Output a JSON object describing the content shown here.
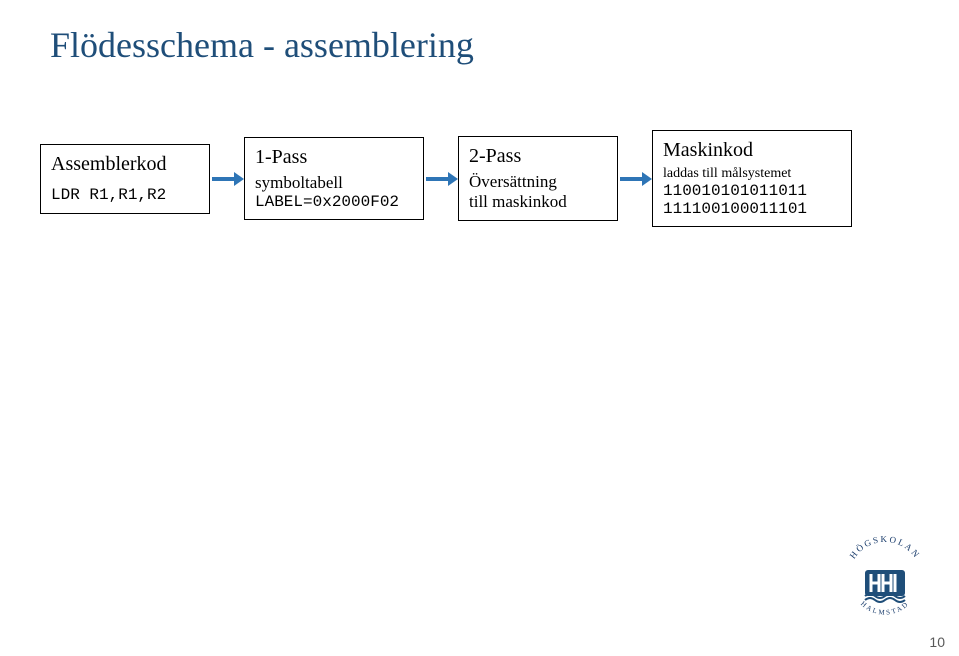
{
  "title": "Flödesschema - assemblering",
  "boxes": [
    {
      "head": "Assemblerkod",
      "sub1": "LDR R1,R1,R2",
      "sub1_style": "mono"
    },
    {
      "head": "1-Pass",
      "sub1": "symboltabell",
      "sub1_style": "serif",
      "sub2": "LABEL=0x2000F02",
      "sub2_style": "mono"
    },
    {
      "head": "2-Pass",
      "sub1": "Översättning",
      "sub1_style": "serif",
      "sub2": "till maskinkod",
      "sub2_style": "serif"
    },
    {
      "head": "Maskinkod",
      "sub1": "laddas till målsystemet",
      "sub1_style": "small",
      "sub2": "110010101011011",
      "sub2_style": "mono",
      "sub3": "111100100011101",
      "sub3_style": "mono"
    }
  ],
  "logo": {
    "top": "HÖGSKOLAN",
    "bottom": "HALMSTAD"
  },
  "pagenum": "10"
}
